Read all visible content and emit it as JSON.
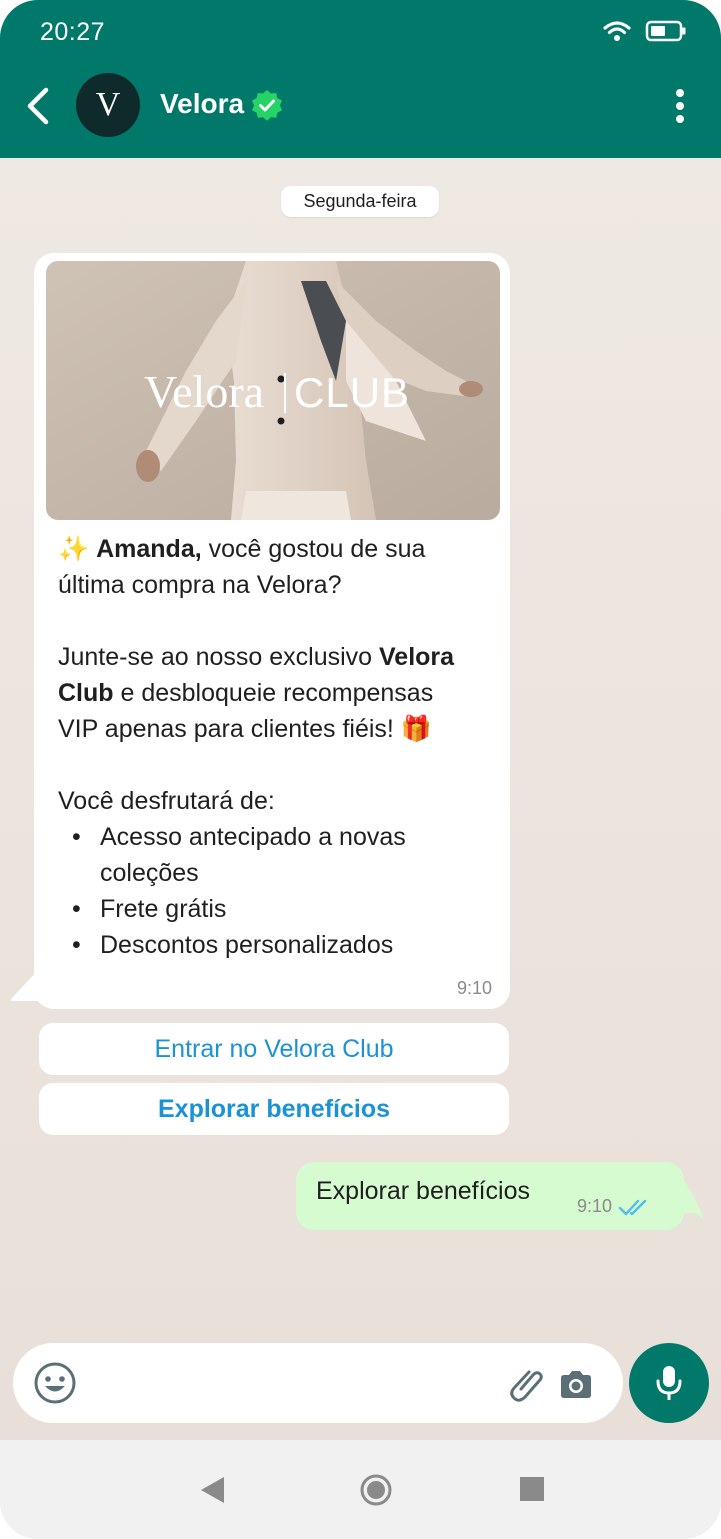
{
  "status_bar": {
    "time": "20:27"
  },
  "header": {
    "contact_name": "Velora",
    "avatar_letter": "V",
    "verified": true
  },
  "chat": {
    "day_label": "Segunda-feira",
    "incoming": {
      "image_text": {
        "brand": "Velora",
        "sub": "CLUB"
      },
      "greeting_emoji": "✨",
      "name_bold": "Amanda,",
      "line1_rest": " você gostou de sua",
      "line2": "última compra na Velora?",
      "p2_a": "Junte-se ao nosso exclusivo ",
      "p2_bold1": "Velora",
      "p2_bold2": "Club",
      "p2_b": " e desbloqueie recompensas",
      "p2_c": "VIP apenas para clientes fiéis! ",
      "gift_emoji": "🎁",
      "p3": "Você desfrutará de:",
      "benefits": [
        "Acesso antecipado a novas coleções",
        "Frete grátis",
        "Descontos personalizados"
      ],
      "time": "9:10"
    },
    "quick_replies": [
      "Entrar no Velora Club",
      "Explorar benefícios"
    ],
    "outgoing": {
      "text": "Explorar benefícios",
      "time": "9:10",
      "status": "read"
    }
  },
  "colors": {
    "header": "#00796b",
    "chat_bg": "#ece4dc",
    "outgoing_bubble": "#d7fbd1",
    "link_blue": "#1a93d6",
    "verified_green": "#25d366",
    "read_ticks": "#53bdeb"
  }
}
